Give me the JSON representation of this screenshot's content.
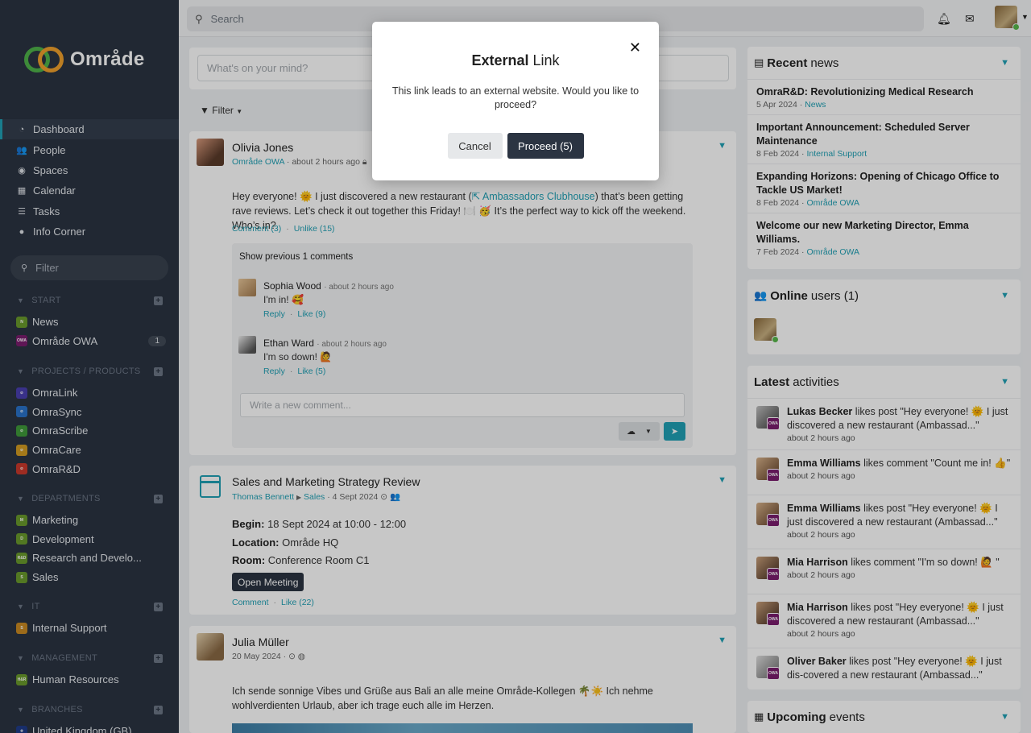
{
  "brand": {
    "name": "Område"
  },
  "colors": {
    "accent": "#21a1b5",
    "sidebar": "#2b3442",
    "online": "#58b84b"
  },
  "sidebar": {
    "nav": [
      {
        "label": "Dashboard",
        "icon": "dashboard-icon"
      },
      {
        "label": "People",
        "icon": "people-icon"
      },
      {
        "label": "Spaces",
        "icon": "spaces-icon"
      },
      {
        "label": "Calendar",
        "icon": "calendar-icon"
      },
      {
        "label": "Tasks",
        "icon": "tasks-icon"
      },
      {
        "label": "Info Corner",
        "icon": "info-icon"
      }
    ],
    "filter_placeholder": "Filter",
    "sections": [
      {
        "title": "START",
        "items": [
          {
            "label": "News",
            "badge": "N"
          },
          {
            "label": "Område OWA",
            "badge": "OWA",
            "count": "1"
          }
        ]
      },
      {
        "title": "PROJECTS / PRODUCTS",
        "items": [
          {
            "label": "OmraLink"
          },
          {
            "label": "OmraSync"
          },
          {
            "label": "OmraScribe"
          },
          {
            "label": "OmraCare"
          },
          {
            "label": "OmraR&D"
          }
        ]
      },
      {
        "title": "DEPARTMENTS",
        "items": [
          {
            "label": "Marketing",
            "badge": "M"
          },
          {
            "label": "Development",
            "badge": "D"
          },
          {
            "label": "Research and Develo...",
            "badge": "R&D"
          },
          {
            "label": "Sales",
            "badge": "S"
          }
        ]
      },
      {
        "title": "IT",
        "items": [
          {
            "label": "Internal Support",
            "badge": "S"
          }
        ]
      },
      {
        "title": "MANAGEMENT",
        "items": [
          {
            "label": "Human Resources",
            "badge": "H&R"
          }
        ]
      },
      {
        "title": "BRANCHES",
        "items": [
          {
            "label": "United Kingdom (GB)"
          }
        ]
      }
    ]
  },
  "topbar": {
    "search_placeholder": "Search"
  },
  "feed": {
    "composer_placeholder": "What's on your mind?",
    "filter_label": "Filter",
    "post1": {
      "author": "Olivia Jones",
      "space": "Område OWA",
      "time": "about 2 hours ago",
      "text_a": "Hey everyone! 🌞 I just discovered a new restaurant (",
      "link": "Ambassadors Clubhouse",
      "text_b": ") that’s been getting rave reviews. Let’s check it out together this Friday! 🍽️ 🥳 It’s the perfect way to kick off the weekend. Who’s in?",
      "comment_action": "Comment (3)",
      "like_action": "Unlike (15)",
      "show_previous": "Show previous 1 comments",
      "comments": [
        {
          "name": "Sophia Wood",
          "time": "about 2 hours ago",
          "text": "I'm in! 🥰",
          "reply": "Reply",
          "like": "Like (9)"
        },
        {
          "name": "Ethan Ward",
          "time": "about 2 hours ago",
          "text": "I'm so down! 🙋",
          "reply": "Reply",
          "like": "Like (5)"
        }
      ],
      "comment_placeholder": "Write a new comment..."
    },
    "post2": {
      "title": "Sales and Marketing Strategy Review",
      "author": "Thomas Bennett",
      "space": "Sales",
      "date": "4 Sept 2024",
      "begin_label": "Begin:",
      "begin_value": "18 Sept 2024 at 10:00 - 12:00",
      "location_label": "Location:",
      "location_value": "Område HQ",
      "room_label": "Room:",
      "room_value": "Conference Room C1",
      "open_button": "Open Meeting",
      "comment_action": "Comment",
      "like_action": "Like (22)"
    },
    "post3": {
      "author": "Julia Müller",
      "date": "20 May 2024",
      "text": "Ich sende sonnige Vibes und Grüße aus Bali an alle meine Område-Kollegen 🌴☀️ Ich nehme wohlverdienten Urlaub, aber ich trage euch alle im Herzen."
    }
  },
  "right": {
    "news": {
      "title_bold": "Recent",
      "title_rest": "news",
      "items": [
        {
          "title": "OmraR&D: Revolutionizing Medical Research",
          "date": "5 Apr 2024",
          "space": "News"
        },
        {
          "title": "Important Announcement: Scheduled Server Maintenance",
          "date": "8 Feb 2024",
          "space": "Internal Support"
        },
        {
          "title": "Expanding Horizons: Opening of Chicago Office to Tackle US Market!",
          "date": "8 Feb 2024",
          "space": "Område OWA"
        },
        {
          "title": "Welcome our new Marketing Director, Emma Williams.",
          "date": "7 Feb 2024",
          "space": "Område OWA"
        }
      ]
    },
    "online": {
      "title_bold": "Online",
      "title_rest": "users (1)"
    },
    "activities": {
      "title_bold": "Latest",
      "title_rest": "activities",
      "items": [
        {
          "name": "Lukas Becker",
          "text": " likes post \"Hey everyone! 🌞 I just discovered a new restaurant (Ambassad...\"",
          "time": "about 2 hours ago"
        },
        {
          "name": "Emma Williams",
          "text": " likes comment \"Count me in! 👍\"",
          "time": "about 2 hours ago"
        },
        {
          "name": "Emma Williams",
          "text": " likes post \"Hey everyone! 🌞 I just discovered a new restaurant (Ambassad...\"",
          "time": "about 2 hours ago"
        },
        {
          "name": "Mia Harrison",
          "text": " likes comment \"I'm so down! 🙋 \"",
          "time": "about 2 hours ago"
        },
        {
          "name": "Mia Harrison",
          "text": " likes post \"Hey everyone! 🌞 I just discovered a new restaurant (Ambassad...\"",
          "time": "about 2 hours ago"
        },
        {
          "name": "Oliver Baker",
          "text": " likes post \"Hey everyone! 🌞 I just dis-covered a new restaurant (Ambassad...\"",
          "time": ""
        }
      ]
    },
    "events": {
      "title_bold": "Upcoming",
      "title_rest": "events"
    }
  },
  "modal": {
    "title_bold": "External",
    "title_rest": "Link",
    "body": "This link leads to an external website. Would you like to proceed?",
    "cancel": "Cancel",
    "proceed": "Proceed (5)"
  }
}
